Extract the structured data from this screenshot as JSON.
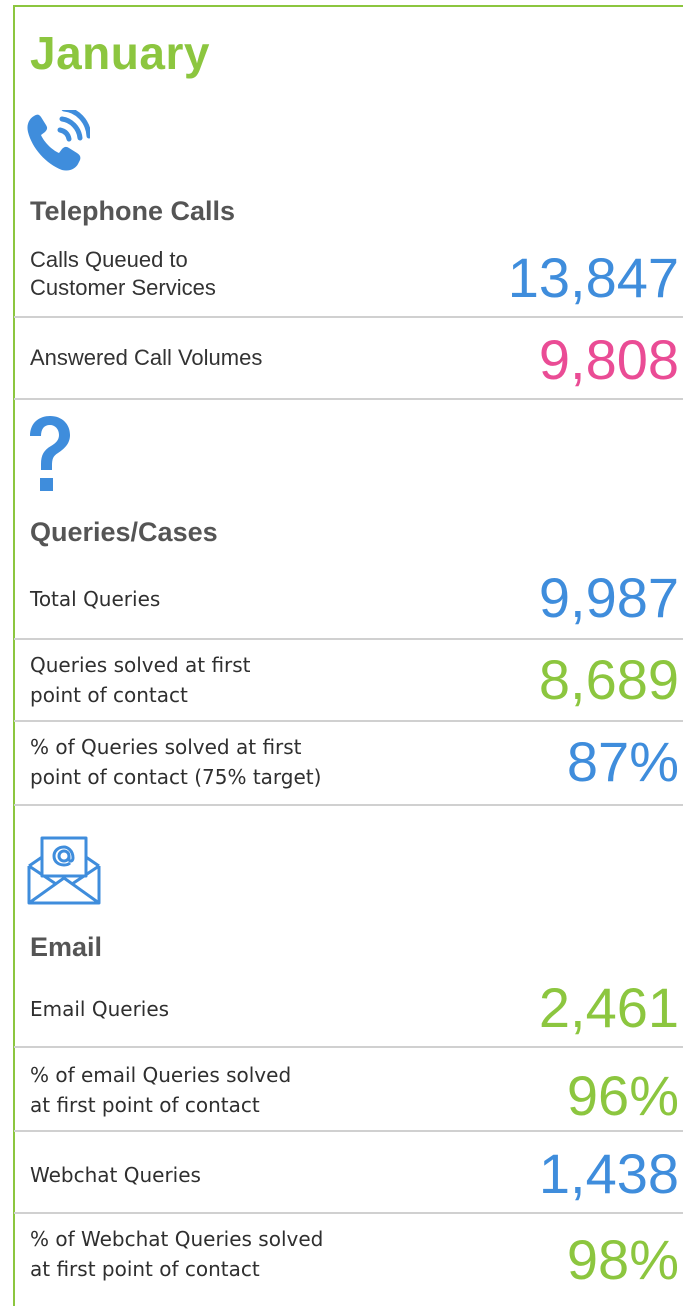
{
  "title": "January",
  "colors": {
    "green": "#8cc63f",
    "blue": "#3f8ddc",
    "pink": "#ea4c95",
    "divider": "#d0d0d0"
  },
  "sections": {
    "telephone": {
      "icon": "phone-icon",
      "heading": "Telephone Calls",
      "rows": [
        {
          "label_line1": "Calls Queued to",
          "label_line2": "Customer Services",
          "value": "13,847",
          "color": "blue"
        },
        {
          "label_line1": "Answered Call Volumes",
          "label_line2": "",
          "value": "9,808",
          "color": "pink"
        }
      ]
    },
    "queries": {
      "icon": "question-mark-icon",
      "heading": "Queries/Cases",
      "rows": [
        {
          "label_line1": "Total Queries",
          "label_line2": "",
          "value": "9,987",
          "color": "blue"
        },
        {
          "label_line1": "Queries solved at first",
          "label_line2": "point of contact",
          "value": "8,689",
          "color": "green"
        },
        {
          "label_line1": "% of Queries solved at first",
          "label_line2": "point of contact (75% target)",
          "value": "87%",
          "color": "blue"
        }
      ]
    },
    "email": {
      "icon": "email-envelope-icon",
      "heading": "Email",
      "rows": [
        {
          "label_line1": "Email Queries",
          "label_line2": "",
          "value": "2,461",
          "color": "green"
        },
        {
          "label_line1": "% of email Queries solved",
          "label_line2": "at first point of contact",
          "value": "96%",
          "color": "green"
        },
        {
          "label_line1": "Webchat Queries",
          "label_line2": "",
          "value": "1,438",
          "color": "blue"
        },
        {
          "label_line1": "% of Webchat Queries solved",
          "label_line2": "at first point of contact",
          "value": "98%",
          "color": "green"
        }
      ]
    }
  }
}
